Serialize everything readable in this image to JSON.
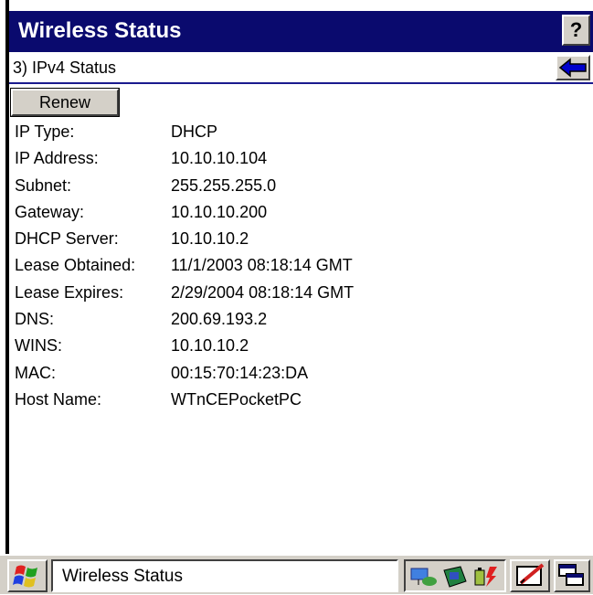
{
  "window": {
    "title": "Wireless Status"
  },
  "subheader": {
    "label": "3) IPv4 Status"
  },
  "buttons": {
    "help_label": "?",
    "renew_label": "Renew"
  },
  "fields": [
    {
      "key": "IP Type:",
      "value": "DHCP"
    },
    {
      "key": "IP Address:",
      "value": "10.10.10.104"
    },
    {
      "key": "Subnet:",
      "value": "255.255.255.0"
    },
    {
      "key": "Gateway:",
      "value": "10.10.10.200"
    },
    {
      "key": "DHCP Server:",
      "value": "10.10.10.2"
    },
    {
      "key": "Lease Obtained:",
      "value": "11/1/2003 08:18:14 GMT"
    },
    {
      "key": "Lease Expires:",
      "value": "2/29/2004 08:18:14 GMT"
    },
    {
      "key": "DNS:",
      "value": "200.69.193.2"
    },
    {
      "key": "WINS:",
      "value": "10.10.10.2"
    },
    {
      "key": "MAC:",
      "value": "00:15:70:14:23:DA"
    },
    {
      "key": "Host Name:",
      "value": "WTnCEPocketPC"
    }
  ],
  "taskbar": {
    "task_label": "Wireless Status",
    "tray_icons": [
      "network-icon",
      "wireless-card-icon",
      "battery-icon"
    ]
  },
  "colors": {
    "titlebar": "#0a0a6e",
    "chrome": "#d4d0c8",
    "accent_arrow": "#0000cc"
  }
}
